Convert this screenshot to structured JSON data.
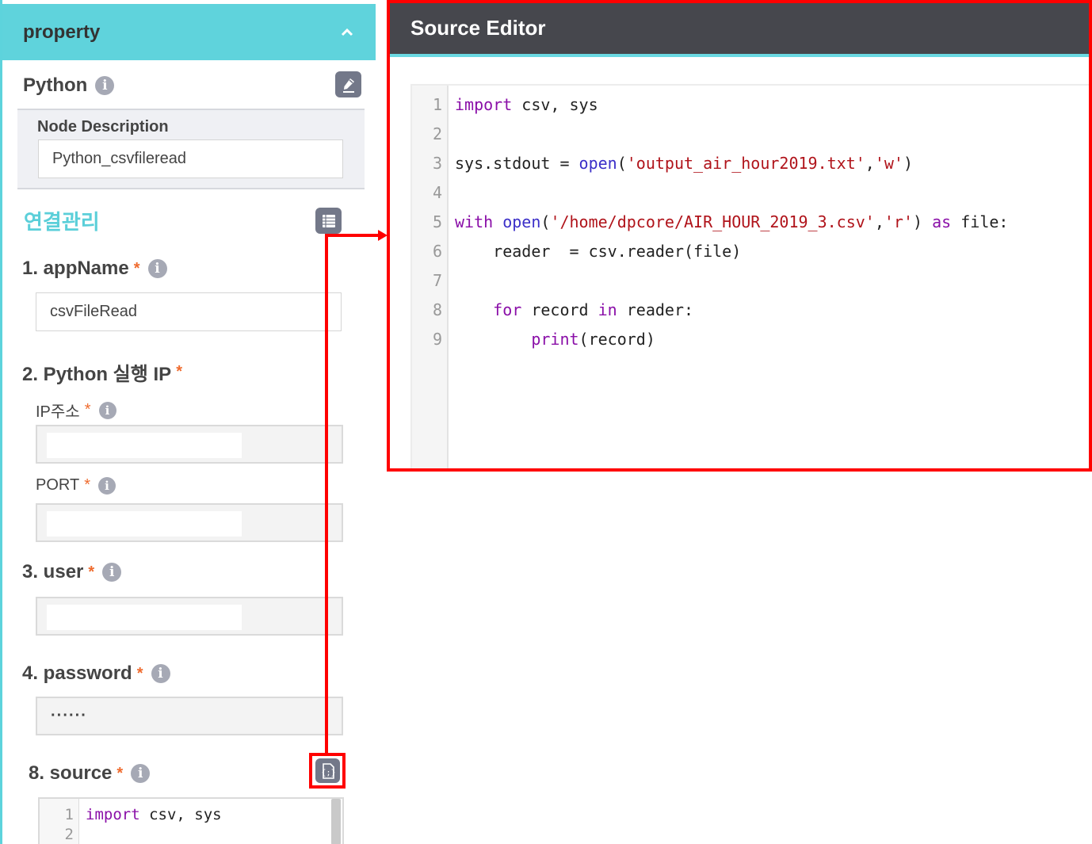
{
  "panel": {
    "title": "property",
    "collapse_icon": "chevron-up-icon",
    "node_title": "Python",
    "edit_icon": "pencil-edit-icon",
    "node_description": {
      "label": "Node Description",
      "value": "Python_csvfileread"
    },
    "section_title": "연결관리",
    "section_icon": "list-table-icon",
    "fields": [
      {
        "label": "1. appName",
        "required": "*",
        "value": "csvFileRead"
      },
      {
        "label": "2. Python 실행 IP",
        "required": "*"
      },
      {
        "label": "IP주소",
        "required": "*",
        "value": ""
      },
      {
        "label": "PORT",
        "required": "*",
        "value": ""
      },
      {
        "label": "3. user",
        "required": "*",
        "value": ""
      },
      {
        "label": "4. password",
        "required": "*",
        "value": "······"
      },
      {
        "label": "8. source",
        "required": "*"
      }
    ],
    "source_icon": "code-file-icon",
    "source_preview": {
      "line_numbers": [
        "1",
        "2"
      ],
      "lines": [
        "import csv, sys",
        ""
      ]
    }
  },
  "editor": {
    "title": "Source Editor",
    "line_numbers": [
      "1",
      "2",
      "3",
      "4",
      "5",
      "6",
      "7",
      "8",
      "9"
    ],
    "lines": [
      [
        {
          "t": "import",
          "c": "kw"
        },
        {
          "t": " csv, sys",
          "c": ""
        }
      ],
      [],
      [
        {
          "t": "sys.stdout = ",
          "c": ""
        },
        {
          "t": "open",
          "c": "bi"
        },
        {
          "t": "(",
          "c": ""
        },
        {
          "t": "'output_air_hour2019.txt'",
          "c": "str"
        },
        {
          "t": ",",
          "c": ""
        },
        {
          "t": "'w'",
          "c": "str"
        },
        {
          "t": ")",
          "c": ""
        }
      ],
      [],
      [
        {
          "t": "with",
          "c": "kw"
        },
        {
          "t": " ",
          "c": ""
        },
        {
          "t": "open",
          "c": "bi"
        },
        {
          "t": "(",
          "c": ""
        },
        {
          "t": "'/home/dpcore/AIR_HOUR_2019_3.csv'",
          "c": "str"
        },
        {
          "t": ",",
          "c": ""
        },
        {
          "t": "'r'",
          "c": "str"
        },
        {
          "t": ") ",
          "c": ""
        },
        {
          "t": "as",
          "c": "kw"
        },
        {
          "t": " file:",
          "c": ""
        }
      ],
      [
        {
          "t": "    reader  = csv.reader(file)",
          "c": ""
        }
      ],
      [],
      [
        {
          "t": "    ",
          "c": ""
        },
        {
          "t": "for",
          "c": "kw"
        },
        {
          "t": " record ",
          "c": ""
        },
        {
          "t": "in",
          "c": "kw"
        },
        {
          "t": " reader:",
          "c": ""
        }
      ],
      [
        {
          "t": "        ",
          "c": ""
        },
        {
          "t": "print",
          "c": "kw"
        },
        {
          "t": "(record)",
          "c": ""
        }
      ]
    ]
  },
  "annotation": {
    "color": "#ff0000",
    "description": "source editor button opens Source Editor"
  },
  "colors": {
    "accent": "#5fd3dc",
    "editor_header": "#46474d",
    "required": "#ef6b2e",
    "keyword": "#8a0fa8",
    "builtin": "#3b2fc8",
    "string": "#b0131a"
  }
}
